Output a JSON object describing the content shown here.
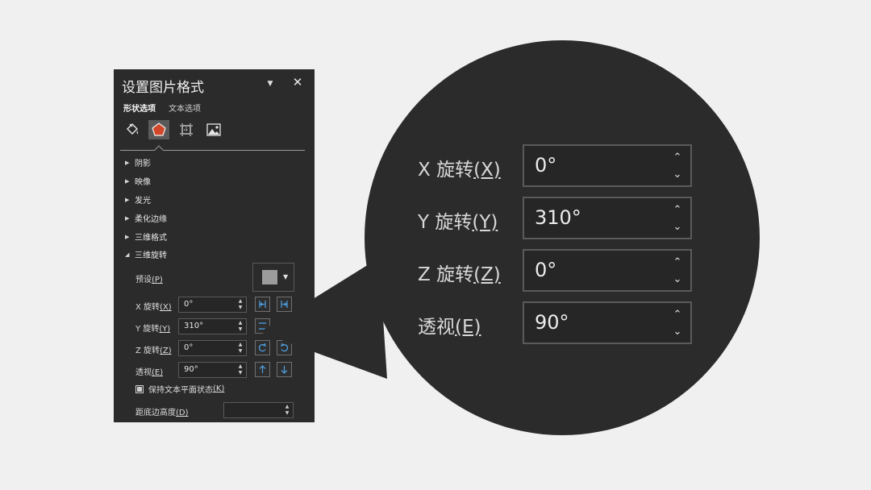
{
  "panel": {
    "title": "设置图片格式",
    "tabs": {
      "shape_options": "形状选项",
      "text_options": "文本选项"
    },
    "category_icons": [
      "fill-line-icon",
      "effects-icon",
      "size-properties-icon",
      "picture-icon"
    ],
    "sections": [
      {
        "label": "阴影",
        "expanded": false
      },
      {
        "label": "映像",
        "expanded": false
      },
      {
        "label": "发光",
        "expanded": false
      },
      {
        "label": "柔化边缘",
        "expanded": false
      },
      {
        "label": "三维格式",
        "expanded": false
      },
      {
        "label": "三维旋转",
        "expanded": true
      }
    ],
    "rotation": {
      "preset": {
        "label": "预设",
        "key": "(P)"
      },
      "x": {
        "label": "X 旋转",
        "key": "(X)",
        "value": "0°"
      },
      "y": {
        "label": "Y 旋转",
        "key": "(Y)",
        "value": "310°"
      },
      "z": {
        "label": "Z 旋转",
        "key": "(Z)",
        "value": "0°"
      },
      "perspective": {
        "label": "透视",
        "key": "(E)",
        "value": "90°"
      },
      "keep_text_flat": {
        "label": "保持文本平面状态",
        "key": "(K)",
        "checked": true
      },
      "distance": {
        "label": "距底边高度",
        "key": "(D)",
        "value": ""
      }
    }
  },
  "zoom": {
    "x": {
      "label": "X 旋转",
      "key": "(X)",
      "value": "0°"
    },
    "y": {
      "label": "Y 旋转",
      "key": "(Y)",
      "value": "310°"
    },
    "z": {
      "label": "Z 旋转",
      "key": "(Z)",
      "value": "0°"
    },
    "perspective": {
      "label": "透视",
      "key": "(E)",
      "value": "90°"
    }
  },
  "colors": {
    "panel_bg": "#2b2b2b",
    "bubble_bg": "#2b2b2b",
    "page_bg": "#f0f0f0",
    "accent_blue": "#4fa3e6",
    "effects_icon_red": "#d2472a"
  }
}
